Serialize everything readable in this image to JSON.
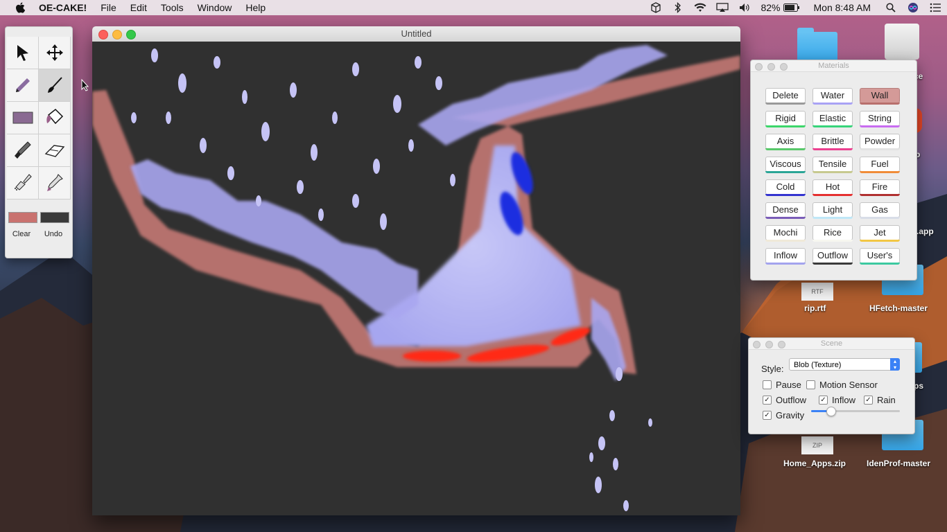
{
  "menubar": {
    "app_name": "OE-CAKE!",
    "menus": [
      "File",
      "Edit",
      "Tools",
      "Window",
      "Help"
    ],
    "battery": "82%",
    "clock": "Mon 8:48 AM"
  },
  "desktop": {
    "items": [
      {
        "label": "rip.rtf",
        "badge": "RTF"
      },
      {
        "label": "HFetch-master"
      },
      {
        "label": "Home_Apps.zip",
        "badge": "ZIP"
      },
      {
        "label": "IdenProf-master"
      }
    ],
    "partial_labels": [
      "ce",
      "p",
      ".app",
      "ps"
    ]
  },
  "tools": {
    "items": [
      {
        "name": "select",
        "icon": "arrow-pointer-icon"
      },
      {
        "name": "move",
        "icon": "move-arrows-icon"
      },
      {
        "name": "pencil",
        "icon": "pencil-icon"
      },
      {
        "name": "brush",
        "icon": "brush-icon",
        "selected": true
      },
      {
        "name": "rectangle",
        "icon": "rectangle-icon"
      },
      {
        "name": "fill",
        "icon": "paint-bucket-icon"
      },
      {
        "name": "knife",
        "icon": "knife-icon"
      },
      {
        "name": "eraser",
        "icon": "eraser-icon"
      },
      {
        "name": "spray",
        "icon": "flashlight-icon"
      },
      {
        "name": "dropper",
        "icon": "dropper-icon"
      }
    ],
    "primary_color": "#c9726f",
    "secondary_color": "#3a3a3a",
    "clear_label": "Clear",
    "undo_label": "Undo"
  },
  "window": {
    "title": "Untitled"
  },
  "materials": {
    "title": "Materials",
    "selected": "Wall",
    "items": [
      {
        "label": "Delete",
        "color": "#9a9a9a"
      },
      {
        "label": "Water",
        "color": "#a9a2f5"
      },
      {
        "label": "Wall",
        "color": "#b8706d"
      },
      {
        "label": "Rigid",
        "color": "#3cd66a"
      },
      {
        "label": "Elastic",
        "color": "#37d47a"
      },
      {
        "label": "String",
        "color": "#c86cf0"
      },
      {
        "label": "Axis",
        "color": "#58c86a"
      },
      {
        "label": "Brittle",
        "color": "#ec3f8f"
      },
      {
        "label": "Powder",
        "color": "#e3e3e3"
      },
      {
        "label": "Viscous",
        "color": "#2aa596"
      },
      {
        "label": "Tensile",
        "color": "#c7c98e"
      },
      {
        "label": "Fuel",
        "color": "#f08c38"
      },
      {
        "label": "Cold",
        "color": "#3434d0"
      },
      {
        "label": "Hot",
        "color": "#e53030"
      },
      {
        "label": "Fire",
        "color": "#b03030"
      },
      {
        "label": "Dense",
        "color": "#7a5cb8"
      },
      {
        "label": "Light",
        "color": "#bfe7f7"
      },
      {
        "label": "Gas",
        "color": "#d8dde8"
      },
      {
        "label": "Mochi",
        "color": "#f0e9d8"
      },
      {
        "label": "Rice",
        "color": "#f7f7f0"
      },
      {
        "label": "Jet",
        "color": "#f2c744"
      },
      {
        "label": "Inflow",
        "color": "#a3a3ee"
      },
      {
        "label": "Outflow",
        "color": "#3a3a3a"
      },
      {
        "label": "User's",
        "color": "#3cc9a0"
      }
    ]
  },
  "scene": {
    "title": "Scene",
    "style_label": "Style:",
    "style_value": "Blob (Texture)",
    "pause_label": "Pause",
    "pause": false,
    "motion_label": "Motion Sensor",
    "motion": false,
    "outflow_label": "Outflow",
    "outflow": true,
    "inflow_label": "Inflow",
    "inflow": true,
    "rain_label": "Rain",
    "rain": true,
    "gravity_label": "Gravity",
    "gravity": true,
    "gravity_level": 0.22
  }
}
